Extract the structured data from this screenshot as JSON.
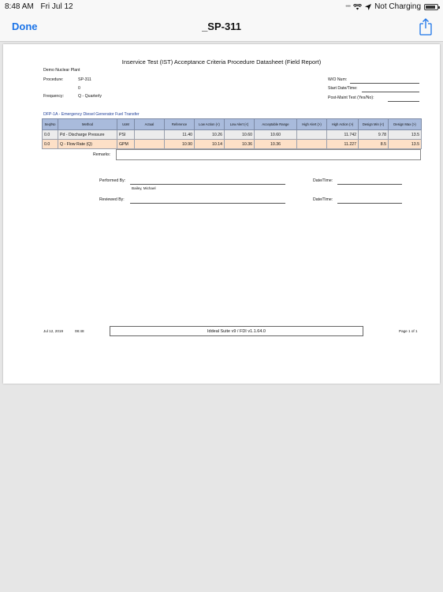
{
  "status_bar": {
    "time": "8:48 AM",
    "date": "Fri Jul 12",
    "charging": "Not Charging",
    "battery_level": 0.85
  },
  "nav": {
    "done_label": "Done",
    "title": "_SP-311",
    "share_icon": "share-icon"
  },
  "doc": {
    "title": "Inservice Test (IST) Acceptance Criteria Procedure Datasheet (Field Report)",
    "plant": "Demo Nuclear Plant",
    "procedure_label": "Procedure:",
    "procedure_value": "SP-311",
    "procedure_rev": "0",
    "frequency_label": "Frequency:",
    "frequency_value": "Q - Quarterly",
    "wo_label": "W/O Num:",
    "start_label": "Start Date/Time:",
    "postmaint_label": "Post-Maint Test (Yes/No):",
    "section_title": "DFP-1A - Emergency Diesel Generator Fuel Transfer",
    "columns": [
      "Seq/No",
      "Method",
      "UoM",
      "Actual",
      "Reference",
      "Low Action (<)",
      "Low Alert (<)",
      "Acceptable Range",
      "High Alert (>)",
      "High Action (>)",
      "Design Min (<)",
      "Design Max (>)"
    ],
    "rows": [
      [
        "0.0",
        "Pd - Discharge Pressure",
        "PSI",
        "",
        "11.40",
        "10.26",
        "10.60",
        "10.60",
        "",
        "11.742",
        "9.78",
        "13.5"
      ],
      [
        "0.0",
        "Q - Flow Rate (Q)",
        "GPM",
        "",
        "10.90",
        "10.14",
        "10.36",
        "10.36",
        "",
        "11.227",
        "8.5",
        "13.5"
      ]
    ],
    "remarks_label": "Remarks:",
    "performed_label": "Performed By:",
    "performed_name": "Bailey, Michael",
    "reviewed_label": "Reviewed By:",
    "datetime_label": "Date/Time:",
    "footer_date": "Jul 12, 2019",
    "footer_time": "08:48",
    "footer_center": "Iddeal Suite v9 / FDI v1.1.64.0",
    "footer_page": "Page 1 of 1"
  }
}
